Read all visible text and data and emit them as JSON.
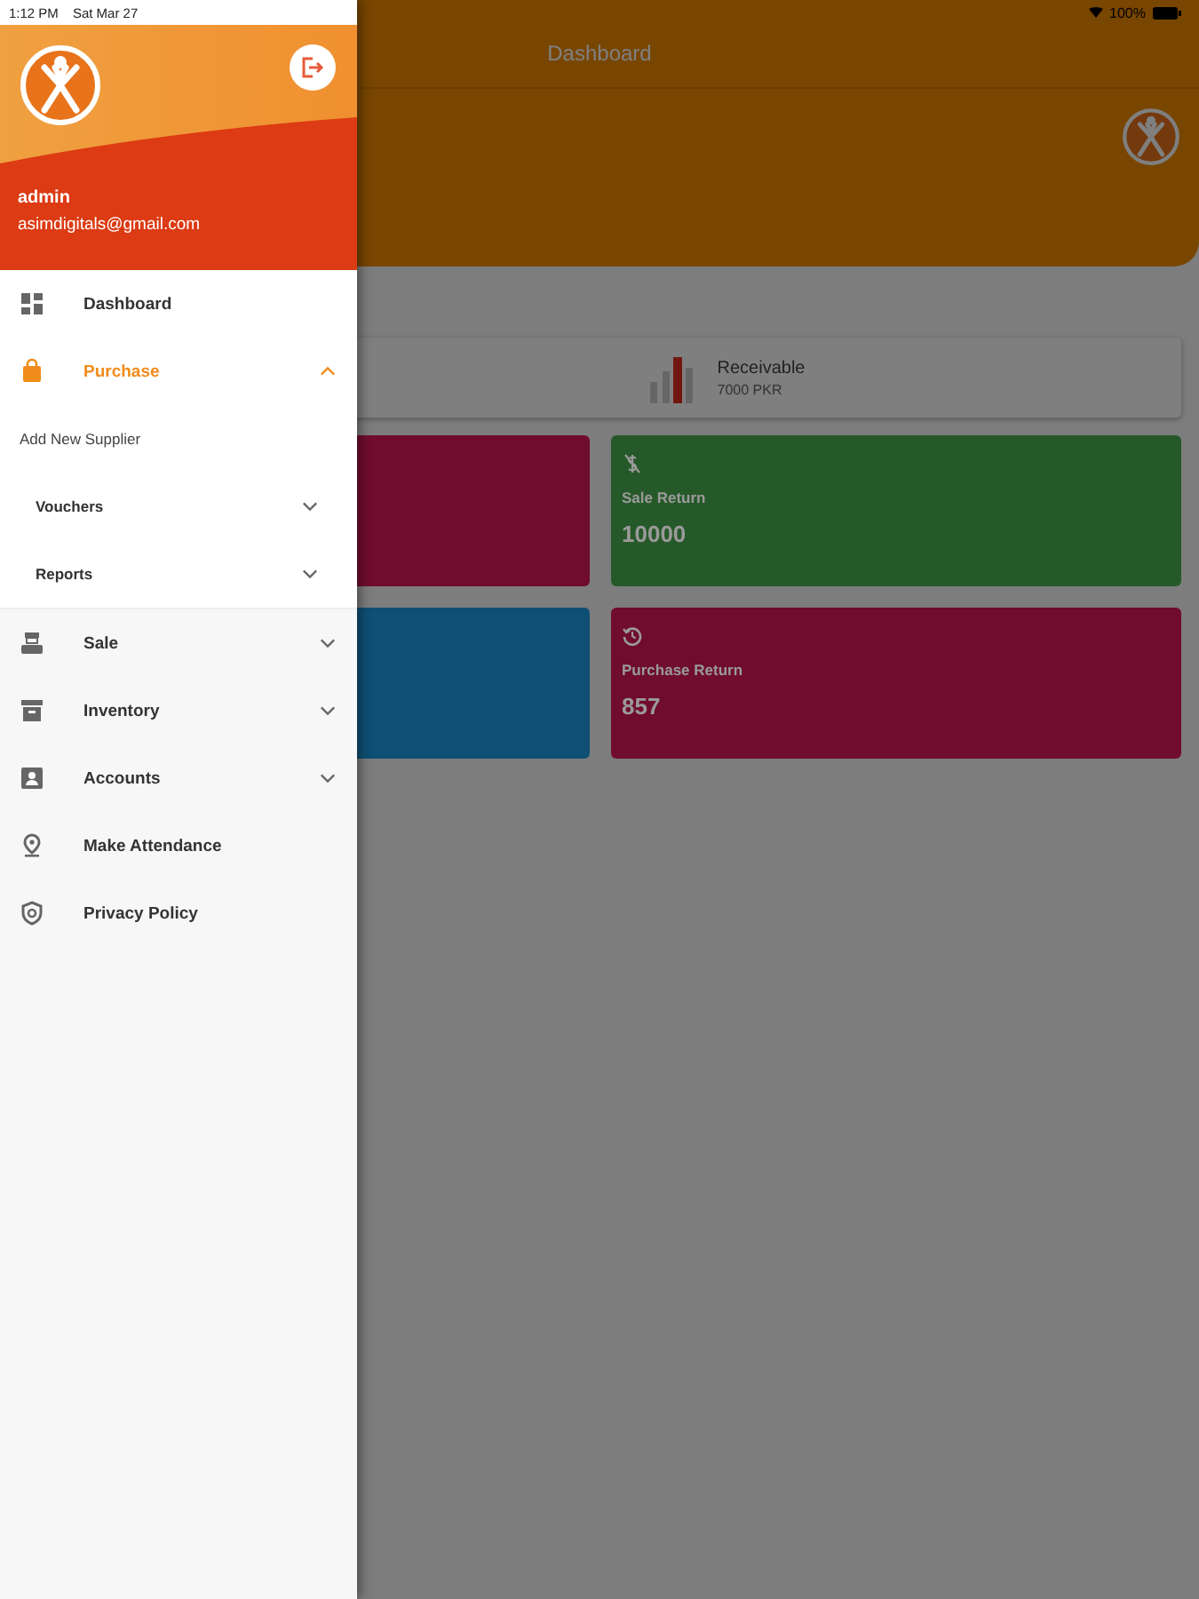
{
  "status_bar": {
    "time": "1:12 PM",
    "date": "Sat Mar 27",
    "battery": "100%"
  },
  "main": {
    "title": "Dashboard",
    "summary": {
      "label": "Receivable",
      "value": "7000 PKR"
    },
    "tiles": [
      {
        "color": "#700c2e"
      },
      {
        "label": "Sale Return",
        "value": "10000",
        "color": "#265929"
      },
      {
        "color": "#0f4f74"
      },
      {
        "label": "Purchase Return",
        "value": "857",
        "color": "#700c2e"
      }
    ]
  },
  "drawer": {
    "user": {
      "name": "admin",
      "email": "asimdigitals@gmail.com"
    },
    "items": [
      {
        "kind": "link",
        "label": "Dashboard",
        "selected": false
      },
      {
        "kind": "group",
        "label": "Purchase",
        "selected": true,
        "expanded": true,
        "children": [
          {
            "kind": "link",
            "label": "Add New Supplier"
          },
          {
            "kind": "group",
            "label": "Vouchers",
            "expanded": false
          },
          {
            "kind": "group",
            "label": "Reports",
            "expanded": false
          }
        ]
      },
      {
        "kind": "group",
        "label": "Sale",
        "selected": false,
        "expanded": false
      },
      {
        "kind": "group",
        "label": "Inventory",
        "selected": false,
        "expanded": false
      },
      {
        "kind": "group",
        "label": "Accounts",
        "selected": false,
        "expanded": false
      },
      {
        "kind": "link",
        "label": "Make Attendance",
        "selected": false
      },
      {
        "kind": "link",
        "label": "Privacy Policy",
        "selected": false
      }
    ]
  }
}
